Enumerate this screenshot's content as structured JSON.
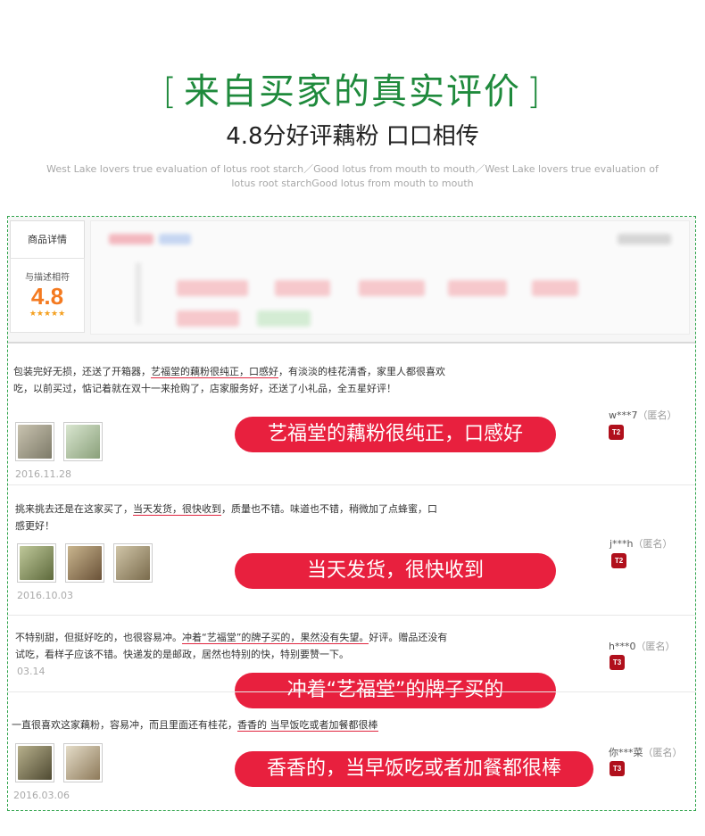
{
  "header": {
    "title_left_bracket": "[",
    "title": "来自买家的真实评价",
    "title_right_bracket": "]",
    "subtitle": "4.8分好评藕粉 口口相传",
    "english": "West Lake lovers true evaluation of lotus root starch／Good lotus from mouth to mouth／West Lake lovers true evaluation of lotus root starchGood lotus from mouth to mouth"
  },
  "colors": {
    "accent_green": "#1f8a3c",
    "pill_red": "#e8203e",
    "rating_orange": "#f47a20"
  },
  "product_panel": {
    "tab_label": "商品详情",
    "rating_label": "与描述相符",
    "rating_value": "4.8",
    "rating_stars": "★★★★★",
    "rating_fraction": 0.96
  },
  "reviews": [
    {
      "text_before": "包装完好无损，还送了开箱器，",
      "text_highlight": "艺福堂的藕粉很纯正，口感好",
      "text_after": "，有淡淡的桂花清香，家里人都很喜欢吃，以前买过，惦记着就在双十一来抢购了，店家服务好，还送了小礼品，全五星好评！",
      "date": "2016.11.28",
      "pill": "艺福堂的藕粉很纯正，口感好",
      "user": "w***7",
      "anon": "（匿名）",
      "badge": "T2",
      "thumb_icons": [
        "photo-icon",
        "photo-icon"
      ]
    },
    {
      "text_before": "挑来挑去还是在这家买了，",
      "text_highlight": "当天发货，很快收到",
      "text_after": "，质量也不错。味道也不错，稍微加了点蜂蜜，口感更好！",
      "date": "2016.10.03",
      "pill": "当天发货，很快收到",
      "user": "j***h",
      "anon": "（匿名）",
      "badge": "T2",
      "thumb_icons": [
        "photo-icon",
        "photo-icon",
        "photo-icon"
      ]
    },
    {
      "text_before": "不特别甜，但挺好吃的，也很容易冲。",
      "text_highlight": "冲着“艺福堂”的牌子买的，果然没有失望。",
      "text_after": "好评。赠品还没有试吃，看样子应该不错。快递发的是邮政，居然也特别的快，特别要赞一下。",
      "date": "03.14",
      "pill": "冲着“艺福堂”的牌子买的",
      "user": "h***0",
      "anon": "（匿名）",
      "badge": "T3",
      "thumb_icons": []
    },
    {
      "text_before": "一直很喜欢这家藕粉，容易冲，而且里面还有桂花，",
      "text_highlight": "香香的 当早饭吃或者加餐都很棒",
      "text_after": "",
      "date": "2016.03.06",
      "pill": "香香的，当早饭吃或者加餐都很棒",
      "user": "你***菜",
      "anon": "（匿名）",
      "badge": "T3",
      "thumb_icons": [
        "photo-icon",
        "photo-icon"
      ]
    }
  ]
}
